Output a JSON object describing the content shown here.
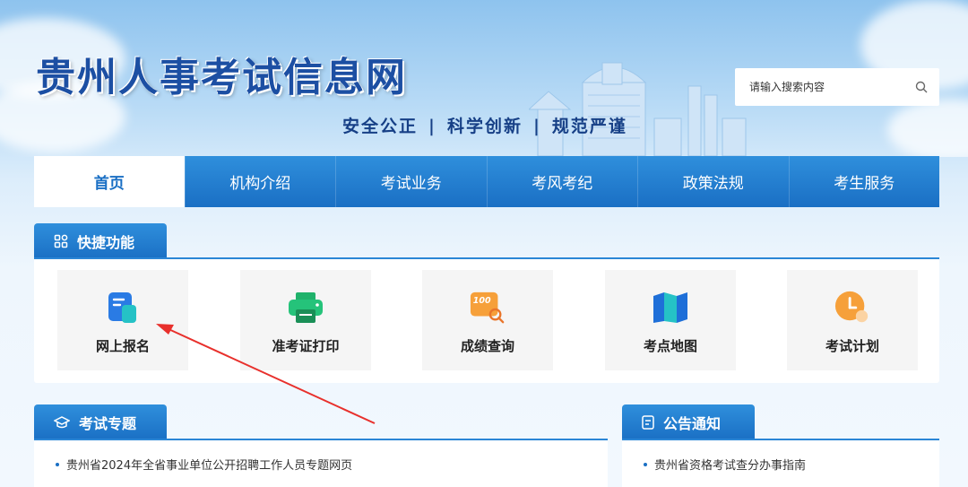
{
  "header": {
    "site_title": "贵州人事考试信息网",
    "slogan": [
      "安全公正",
      "科学创新",
      "规范严谨"
    ],
    "slogan_separator": "|",
    "search_placeholder": "请输入搜索内容",
    "search_icon": "search-icon"
  },
  "nav": {
    "items": [
      {
        "label": "首页",
        "active": true
      },
      {
        "label": "机构介绍",
        "active": false
      },
      {
        "label": "考试业务",
        "active": false
      },
      {
        "label": "考风考纪",
        "active": false
      },
      {
        "label": "政策法规",
        "active": false
      },
      {
        "label": "考生服务",
        "active": false
      }
    ]
  },
  "quick": {
    "title": "快捷功能",
    "icon": "grid-icon",
    "items": [
      {
        "label": "网上报名",
        "icon": "register-form-icon"
      },
      {
        "label": "准考证打印",
        "icon": "printer-icon"
      },
      {
        "label": "成绩查询",
        "icon": "score-search-icon",
        "badge": "100"
      },
      {
        "label": "考点地图",
        "icon": "map-icon"
      },
      {
        "label": "考试计划",
        "icon": "clock-icon"
      }
    ]
  },
  "topics": {
    "title": "考试专题",
    "icon": "graduation-cap-icon",
    "items": [
      "贵州省2024年全省事业单位公开招聘工作人员专题网页"
    ]
  },
  "notices": {
    "title": "公告通知",
    "icon": "document-icon",
    "items": [
      "贵州省资格考试查分办事指南"
    ]
  },
  "colors": {
    "primary": "#1a6fc4",
    "title": "#1c4fa3",
    "annotation_arrow": "#e8302c"
  }
}
